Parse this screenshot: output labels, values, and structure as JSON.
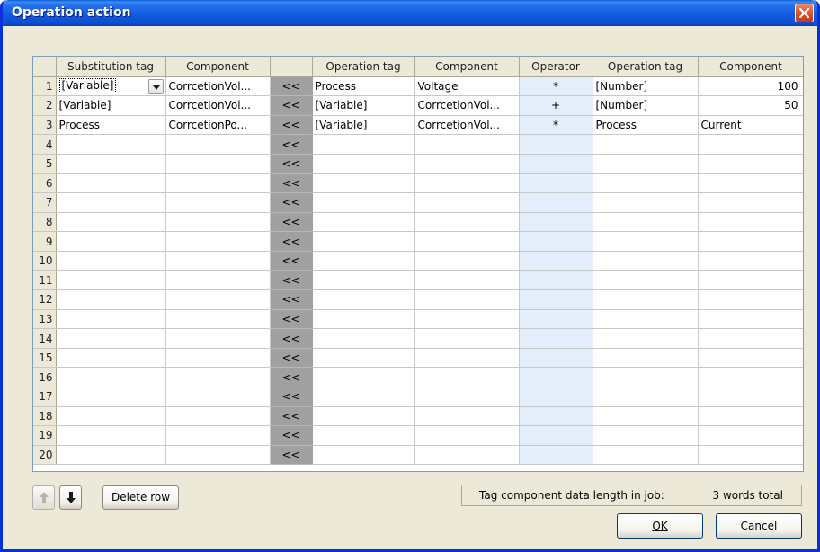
{
  "window": {
    "title": "Operation action",
    "close_glyph": "×"
  },
  "grid": {
    "headers": [
      "",
      "Substitution tag",
      "Component",
      "",
      "Operation tag",
      "Component",
      "Operator",
      "Operation tag",
      "Component"
    ],
    "arrow_label": "<<",
    "rows": [
      {
        "num": "1",
        "sub_tag": "[Variable]",
        "sub_comp": "CorrcetionVol...",
        "op_tag1": "Process",
        "op_comp1": "Voltage",
        "operator": "*",
        "op_tag2": "[Number]",
        "op_comp2": "100"
      },
      {
        "num": "2",
        "sub_tag": "[Variable]",
        "sub_comp": "CorrcetionVol...",
        "op_tag1": "[Variable]",
        "op_comp1": "CorrcetionVol...",
        "operator": "+",
        "op_tag2": "[Number]",
        "op_comp2": "50"
      },
      {
        "num": "3",
        "sub_tag": "Process",
        "sub_comp": "CorrcetionPo...",
        "op_tag1": "[Variable]",
        "op_comp1": "CorrcetionVol...",
        "operator": "*",
        "op_tag2": "Process",
        "op_comp2": "Current"
      },
      {
        "num": "4",
        "sub_tag": "",
        "sub_comp": "",
        "op_tag1": "",
        "op_comp1": "",
        "operator": "",
        "op_tag2": "",
        "op_comp2": ""
      },
      {
        "num": "5",
        "sub_tag": "",
        "sub_comp": "",
        "op_tag1": "",
        "op_comp1": "",
        "operator": "",
        "op_tag2": "",
        "op_comp2": ""
      },
      {
        "num": "6",
        "sub_tag": "",
        "sub_comp": "",
        "op_tag1": "",
        "op_comp1": "",
        "operator": "",
        "op_tag2": "",
        "op_comp2": ""
      },
      {
        "num": "7",
        "sub_tag": "",
        "sub_comp": "",
        "op_tag1": "",
        "op_comp1": "",
        "operator": "",
        "op_tag2": "",
        "op_comp2": ""
      },
      {
        "num": "8",
        "sub_tag": "",
        "sub_comp": "",
        "op_tag1": "",
        "op_comp1": "",
        "operator": "",
        "op_tag2": "",
        "op_comp2": ""
      },
      {
        "num": "9",
        "sub_tag": "",
        "sub_comp": "",
        "op_tag1": "",
        "op_comp1": "",
        "operator": "",
        "op_tag2": "",
        "op_comp2": ""
      },
      {
        "num": "10",
        "sub_tag": "",
        "sub_comp": "",
        "op_tag1": "",
        "op_comp1": "",
        "operator": "",
        "op_tag2": "",
        "op_comp2": ""
      },
      {
        "num": "11",
        "sub_tag": "",
        "sub_comp": "",
        "op_tag1": "",
        "op_comp1": "",
        "operator": "",
        "op_tag2": "",
        "op_comp2": ""
      },
      {
        "num": "12",
        "sub_tag": "",
        "sub_comp": "",
        "op_tag1": "",
        "op_comp1": "",
        "operator": "",
        "op_tag2": "",
        "op_comp2": ""
      },
      {
        "num": "13",
        "sub_tag": "",
        "sub_comp": "",
        "op_tag1": "",
        "op_comp1": "",
        "operator": "",
        "op_tag2": "",
        "op_comp2": ""
      },
      {
        "num": "14",
        "sub_tag": "",
        "sub_comp": "",
        "op_tag1": "",
        "op_comp1": "",
        "operator": "",
        "op_tag2": "",
        "op_comp2": ""
      },
      {
        "num": "15",
        "sub_tag": "",
        "sub_comp": "",
        "op_tag1": "",
        "op_comp1": "",
        "operator": "",
        "op_tag2": "",
        "op_comp2": ""
      },
      {
        "num": "16",
        "sub_tag": "",
        "sub_comp": "",
        "op_tag1": "",
        "op_comp1": "",
        "operator": "",
        "op_tag2": "",
        "op_comp2": ""
      },
      {
        "num": "17",
        "sub_tag": "",
        "sub_comp": "",
        "op_tag1": "",
        "op_comp1": "",
        "operator": "",
        "op_tag2": "",
        "op_comp2": ""
      },
      {
        "num": "18",
        "sub_tag": "",
        "sub_comp": "",
        "op_tag1": "",
        "op_comp1": "",
        "operator": "",
        "op_tag2": "",
        "op_comp2": ""
      },
      {
        "num": "19",
        "sub_tag": "",
        "sub_comp": "",
        "op_tag1": "",
        "op_comp1": "",
        "operator": "",
        "op_tag2": "",
        "op_comp2": ""
      },
      {
        "num": "20",
        "sub_tag": "",
        "sub_comp": "",
        "op_tag1": "",
        "op_comp1": "",
        "operator": "",
        "op_tag2": "",
        "op_comp2": ""
      }
    ]
  },
  "toolbar": {
    "move_up_icon": "arrow-up-icon",
    "move_down_icon": "arrow-down-icon",
    "delete_row_label": "Delete row"
  },
  "status": {
    "label": "Tag component data length in job:",
    "value": "3 words total"
  },
  "buttons": {
    "ok_label": "OK",
    "cancel_label": "Cancel"
  },
  "colors": {
    "titlebar": "#0d4fd0",
    "arrow_column": "#a0a0a0",
    "operator_column": "#e4eefa",
    "dialog_bg": "#ece9d8"
  }
}
